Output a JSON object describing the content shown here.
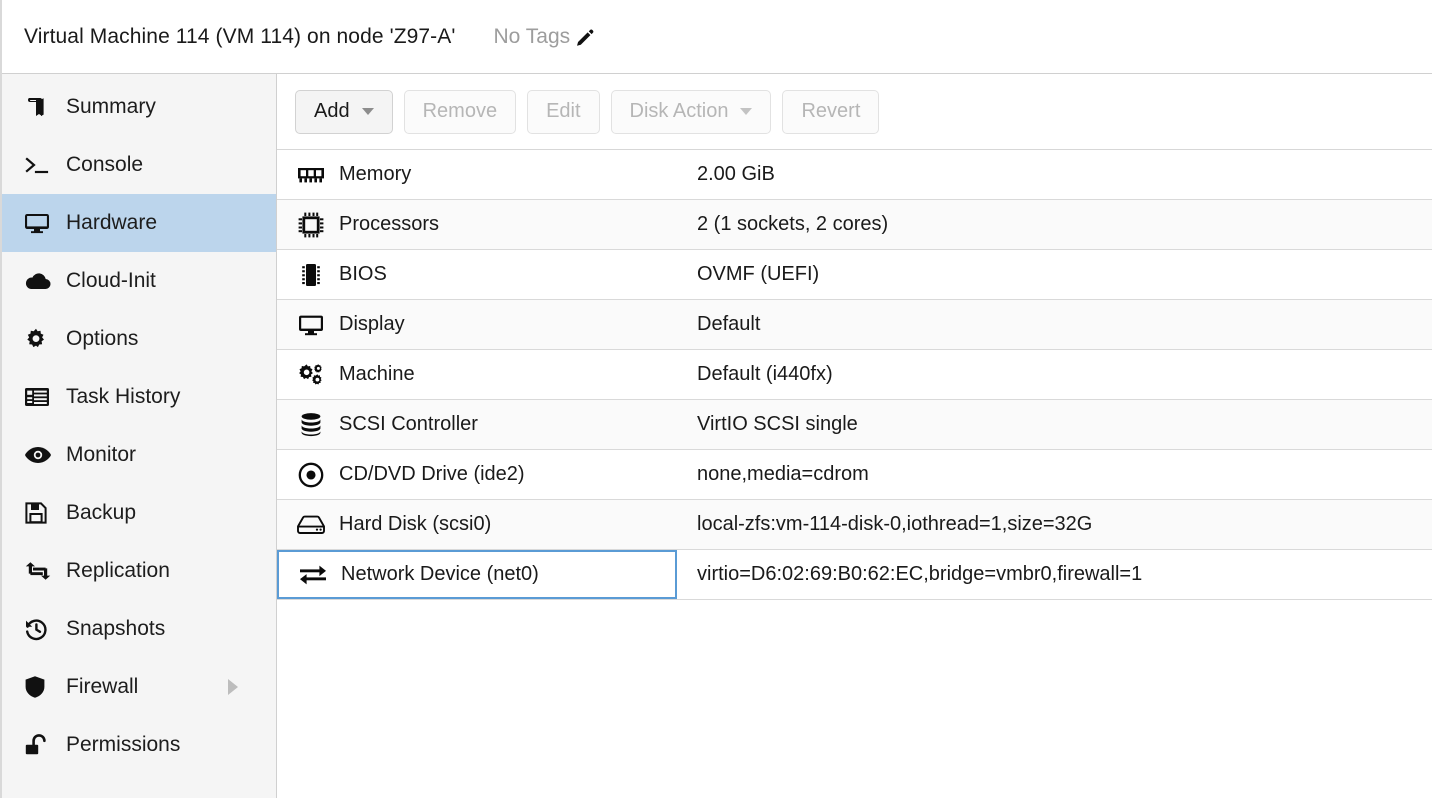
{
  "header": {
    "title": "Virtual Machine 114 (VM 114) on node 'Z97-A'",
    "tags_label": "No Tags",
    "edit_icon": "pencil-icon"
  },
  "sidebar": {
    "items": [
      {
        "label": "Summary",
        "icon": "book-icon",
        "selected": false,
        "submenu": false
      },
      {
        "label": "Console",
        "icon": "terminal-icon",
        "selected": false,
        "submenu": false
      },
      {
        "label": "Hardware",
        "icon": "monitor-icon",
        "selected": true,
        "submenu": false
      },
      {
        "label": "Cloud-Init",
        "icon": "cloud-icon",
        "selected": false,
        "submenu": false
      },
      {
        "label": "Options",
        "icon": "gear-icon",
        "selected": false,
        "submenu": false
      },
      {
        "label": "Task History",
        "icon": "list-icon",
        "selected": false,
        "submenu": false
      },
      {
        "label": "Monitor",
        "icon": "eye-icon",
        "selected": false,
        "submenu": false
      },
      {
        "label": "Backup",
        "icon": "floppy-disk-icon",
        "selected": false,
        "submenu": false
      },
      {
        "label": "Replication",
        "icon": "retweet-icon",
        "selected": false,
        "submenu": false
      },
      {
        "label": "Snapshots",
        "icon": "history-icon",
        "selected": false,
        "submenu": false
      },
      {
        "label": "Firewall",
        "icon": "shield-icon",
        "selected": false,
        "submenu": true
      },
      {
        "label": "Permissions",
        "icon": "unlock-icon",
        "selected": false,
        "submenu": false
      }
    ]
  },
  "toolbar": {
    "buttons": [
      {
        "label": "Add",
        "enabled": true,
        "caret": true
      },
      {
        "label": "Remove",
        "enabled": false,
        "caret": false
      },
      {
        "label": "Edit",
        "enabled": false,
        "caret": false
      },
      {
        "label": "Disk Action",
        "enabled": false,
        "caret": true
      },
      {
        "label": "Revert",
        "enabled": false,
        "caret": false
      }
    ]
  },
  "hardware": {
    "rows": [
      {
        "key": "Memory",
        "value": "2.00 GiB",
        "icon": "memory-icon",
        "selected": false
      },
      {
        "key": "Processors",
        "value": "2 (1 sockets, 2 cores)",
        "icon": "cpu-icon",
        "selected": false
      },
      {
        "key": "BIOS",
        "value": "OVMF (UEFI)",
        "icon": "chip-icon",
        "selected": false
      },
      {
        "key": "Display",
        "value": "Default",
        "icon": "monitor-icon",
        "selected": false
      },
      {
        "key": "Machine",
        "value": "Default (i440fx)",
        "icon": "cogs-icon",
        "selected": false
      },
      {
        "key": "SCSI Controller",
        "value": "VirtIO SCSI single",
        "icon": "database-icon",
        "selected": false
      },
      {
        "key": "CD/DVD Drive (ide2)",
        "value": "none,media=cdrom",
        "icon": "disc-icon",
        "selected": false
      },
      {
        "key": "Hard Disk (scsi0)",
        "value": "local-zfs:vm-114-disk-0,iothread=1,size=32G",
        "icon": "hdd-icon",
        "selected": false
      },
      {
        "key": "Network Device (net0)",
        "value": "virtio=D6:02:69:B0:62:EC,bridge=vmbr0,firewall=1",
        "icon": "exchange-icon",
        "selected": true
      }
    ]
  },
  "colors": {
    "selection_blue": "#bcd5ec",
    "focus_border": "#5a9bd5",
    "sidebar_bg": "#f5f5f5",
    "row_alt_bg": "#fafafa",
    "disabled_text": "#b6b6b6"
  }
}
